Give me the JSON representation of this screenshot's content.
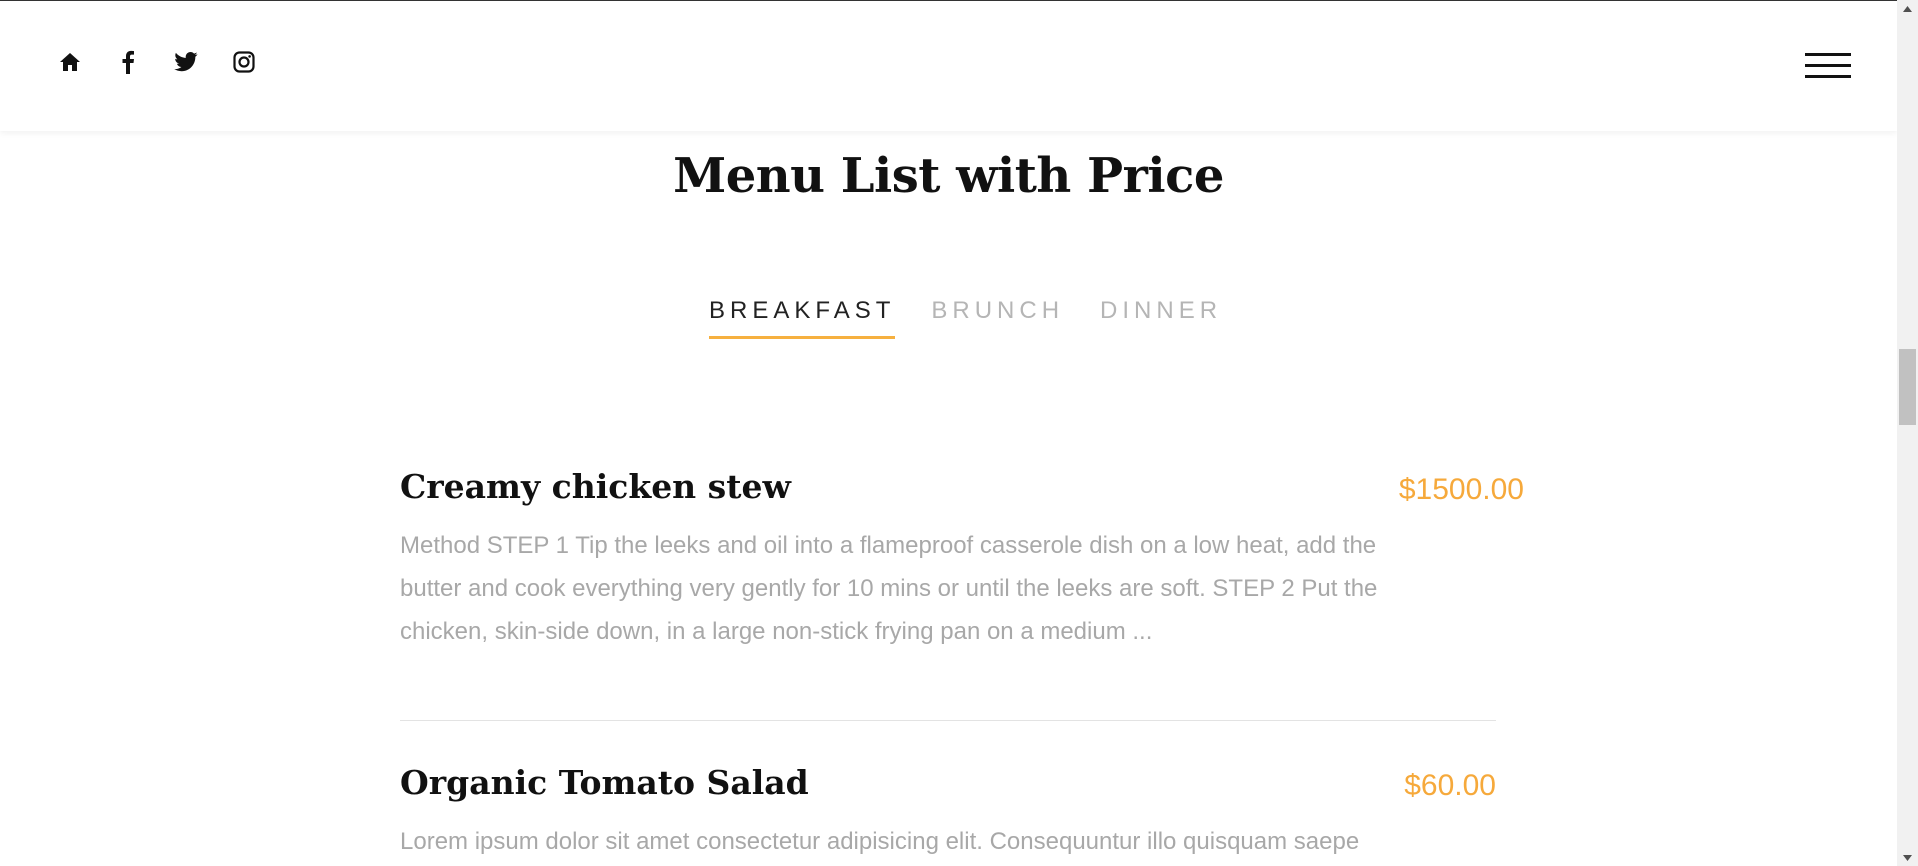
{
  "header": {
    "social_icons": [
      "home-icon",
      "facebook-icon",
      "twitter-icon",
      "instagram-icon"
    ],
    "menu_icon": "hamburger-menu-icon"
  },
  "page_title": "Menu List with Price",
  "tabs": [
    {
      "label": "BREAKFAST",
      "active": true
    },
    {
      "label": "BRUNCH",
      "active": false
    },
    {
      "label": "DINNER",
      "active": false
    }
  ],
  "items": [
    {
      "name": "Creamy chicken stew",
      "price": "$1500.00",
      "description": "Method STEP 1 Tip the leeks and oil into a flameproof casserole dish on a low heat, add the butter and cook everything very gently for 10 mins or until the leeks are soft. STEP 2 Put the chicken, skin-side down, in a large non-stick frying pan on a medium ..."
    },
    {
      "name": "Organic Tomato Salad",
      "price": "$60.00",
      "description": "Lorem ipsum dolor sit amet consectetur adipisicing elit. Consequuntur illo quisquam saepe"
    }
  ],
  "colors": {
    "accent": "#f6a93b",
    "text_dark": "#111111",
    "text_muted": "#a8a8a8"
  }
}
